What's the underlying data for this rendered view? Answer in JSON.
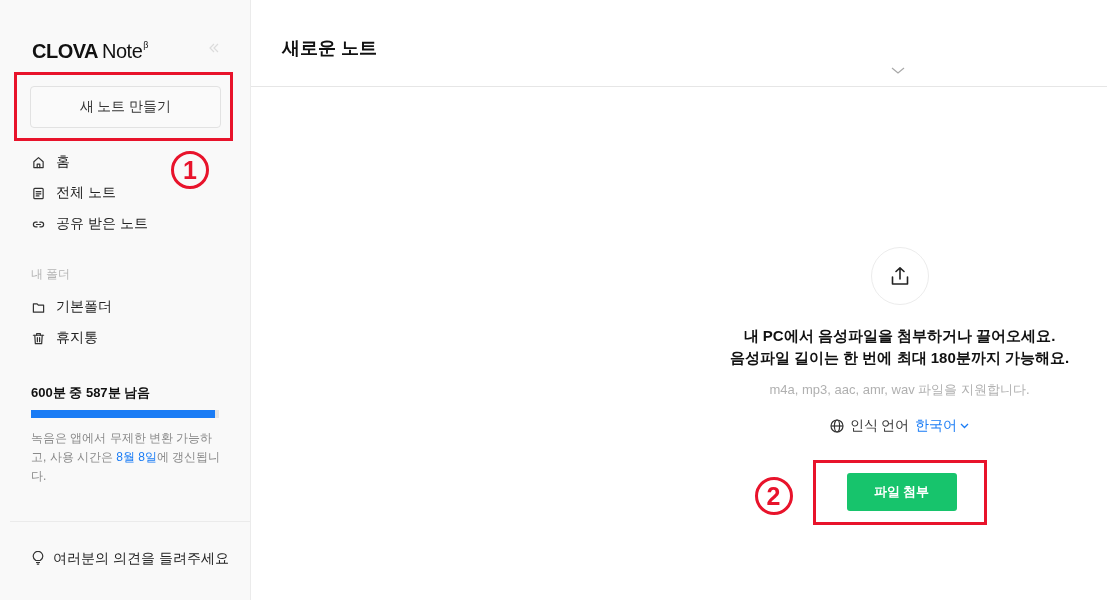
{
  "sidebar": {
    "logo": {
      "brand": "CLOVA",
      "product": "Note",
      "badge": "β"
    },
    "new_note_button": {
      "label": "새 노트 만들기",
      "highlighted": true,
      "marker": "1"
    },
    "nav_items": [
      {
        "label": "홈",
        "kind": "home"
      },
      {
        "label": "전체 노트",
        "kind": "notes"
      },
      {
        "label": "공유 받은 노트",
        "kind": "shared"
      }
    ],
    "folders_heading": "내 폴더",
    "folders": [
      {
        "label": "기본폴더",
        "kind": "folder"
      },
      {
        "label": "휴지통",
        "kind": "trash"
      }
    ],
    "usage": {
      "title": "600분 중 587분 남음",
      "level": 0.98,
      "note": [
        {
          "text": "녹음은 앱에서 무제한 변환 가능하고, 사용 시간은 ",
          "kind": "plain"
        },
        {
          "text": "8월 8일",
          "kind": "date"
        },
        {
          "text": "에 갱신됩니다.",
          "kind": "plain"
        }
      ]
    },
    "feedback": "여러분의 의견을 들려주세요"
  },
  "main": {
    "title": "새로운 노트",
    "upload": {
      "message_lines": [
        "내 PC에서 음성파일을 첨부하거나 끌어오세요.",
        "음성파일 길이는 한 번에 최대 180분까지 가능해요."
      ],
      "formats": "m4a, mp3, aac, amr, wav 파일을 지원합니다.",
      "language_label": "인식 언어",
      "language_value": "한국어",
      "attach_button": {
        "label": "파일 첨부",
        "highlighted": true,
        "marker": "2"
      }
    }
  }
}
